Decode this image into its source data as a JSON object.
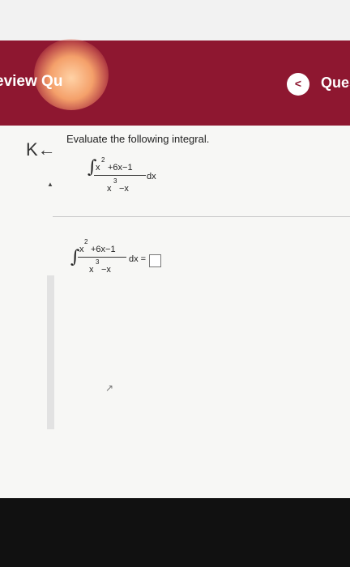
{
  "header": {
    "title": "eview Qu",
    "back_symbol": "<",
    "right_label": "Ques"
  },
  "sidebar": {
    "collapse_symbol": "K←",
    "triangle": "▲"
  },
  "question": {
    "prompt": "Evaluate the following integral.",
    "integral": {
      "sign": "∫",
      "numerator_x": "x",
      "numerator_exp": "2",
      "numerator_rest": "+6x−1",
      "denominator_x": "x",
      "denominator_exp": "3",
      "denominator_rest": "−x",
      "differential": "dx"
    },
    "answer_row": {
      "sign": "∫",
      "numerator_x": "x",
      "numerator_exp": "2",
      "numerator_rest": "+6x−1",
      "denominator_x": "x",
      "denominator_exp": "3",
      "denominator_rest": "−x",
      "equals": "dx ="
    }
  }
}
